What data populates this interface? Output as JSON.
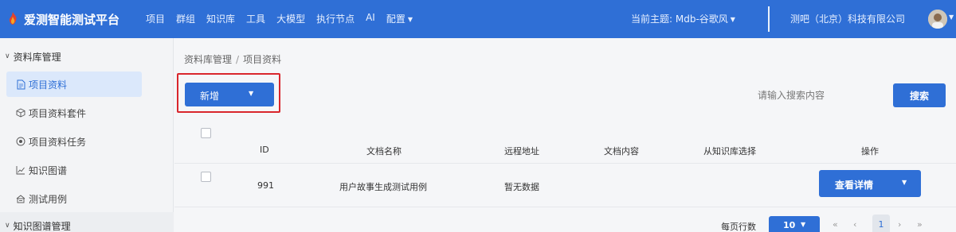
{
  "header": {
    "app_title": "爱测智能测试平台",
    "nav": [
      "项目",
      "群组",
      "知识库",
      "工具",
      "大模型",
      "执行节点",
      "AI",
      "配置"
    ],
    "theme_label": "当前主题: Mdb-谷歌风",
    "company": "测吧（北京）科技有限公司",
    "brand_color": "#2f6fd6"
  },
  "sidebar": {
    "group1": "资料库管理",
    "items": [
      {
        "label": "项目资料",
        "icon": "document-icon",
        "active": true
      },
      {
        "label": "项目资料套件",
        "icon": "cube-icon",
        "active": false
      },
      {
        "label": "项目资料任务",
        "icon": "target-icon",
        "active": false
      },
      {
        "label": "知识图谱",
        "icon": "chart-line-icon",
        "active": false
      },
      {
        "label": "测试用例",
        "icon": "cases-icon",
        "active": false
      }
    ],
    "group2": "知识图谱管理"
  },
  "breadcrumb": [
    "资料库管理",
    "项目资料"
  ],
  "toolbar": {
    "new_label": "新增",
    "search_placeholder": "请输入搜索内容",
    "search_label": "搜索"
  },
  "table": {
    "headers": [
      "ID",
      "文档名称",
      "远程地址",
      "文档内容",
      "从知识库选择",
      "操作"
    ],
    "rows": [
      {
        "id": "991",
        "name": "用户故事生成测试用例",
        "remote": "暂无数据",
        "content": "",
        "kb": "",
        "action": "查看详情"
      }
    ]
  },
  "pagination": {
    "per_page_label": "每页行数",
    "page_size": "10",
    "current_page": "1"
  }
}
